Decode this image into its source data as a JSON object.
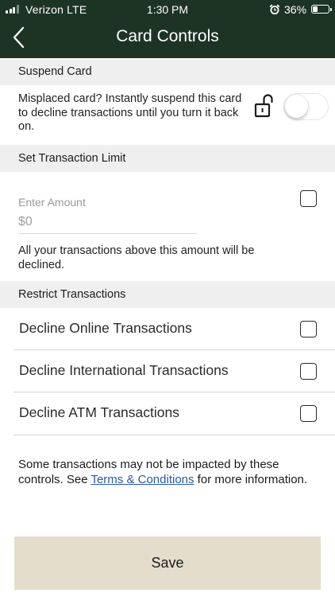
{
  "status_bar": {
    "carrier": "Verizon  LTE",
    "time": "1:30 PM",
    "battery": "36%",
    "battery_level": 0.36
  },
  "nav": {
    "title": "Card Controls"
  },
  "suspend": {
    "section_title": "Suspend Card",
    "description": "Misplaced card? Instantly suspend this card to decline transactions until you turn it back on.",
    "toggle_on": false
  },
  "limit": {
    "section_title": "Set Transaction Limit",
    "input_label": "Enter Amount",
    "input_placeholder": "$0",
    "note": "All your transactions above this amount will be declined.",
    "checked": false
  },
  "restrict": {
    "section_title": "Restrict Transactions",
    "items": [
      {
        "label": "Decline Online Transactions",
        "checked": false
      },
      {
        "label": "Decline International Transactions",
        "checked": false
      },
      {
        "label": "Decline ATM Transactions",
        "checked": false
      }
    ]
  },
  "footer": {
    "text_before": "Some transactions may not be impacted by these controls. See ",
    "link_text": "Terms & Conditions",
    "text_after": " for more information."
  },
  "save_label": "Save",
  "colors": {
    "header_bg": "#1d3425",
    "section_bg": "#efefef",
    "save_bg": "#e4ddcc",
    "link": "#2a59a8"
  },
  "icons": {
    "back": "chevron-left-icon",
    "lock": "unlock-icon",
    "alarm": "alarm-clock-icon"
  }
}
